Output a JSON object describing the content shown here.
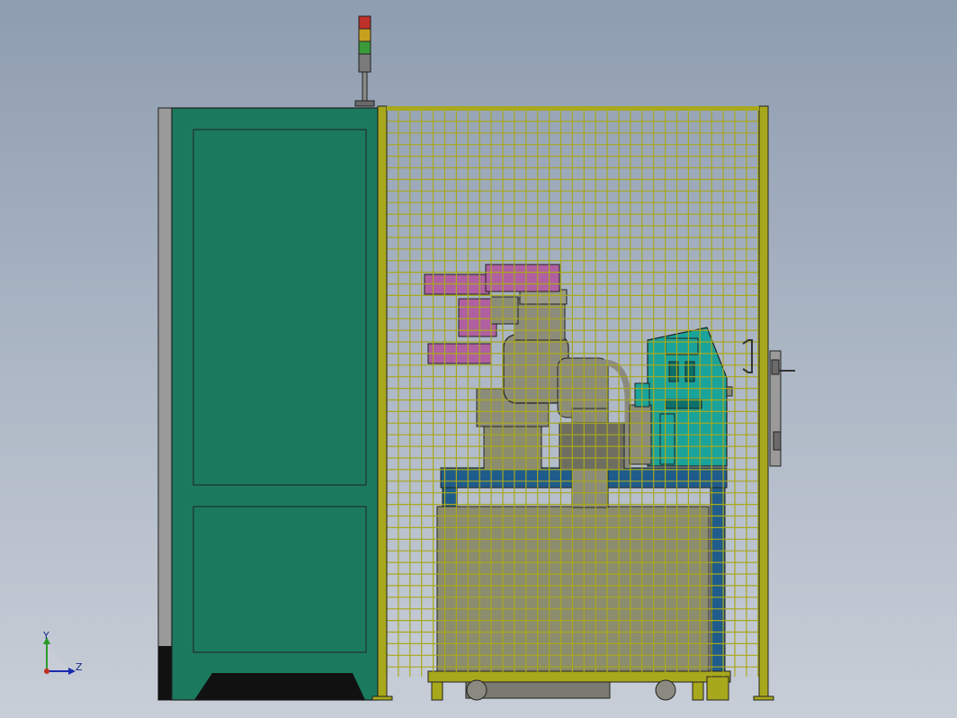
{
  "viewport": {
    "background_top": "#8e9db0",
    "background_bottom": "#c8ced7"
  },
  "colors": {
    "cabinet_green": "#1b7a5e",
    "fence_yellow": "#a8a81c",
    "frame_blue": "#1f5c8c",
    "robot_gray": "#8c8c7a",
    "magenta": "#b060a0",
    "teal": "#1aa39a",
    "beacon_red": "#c0302a",
    "beacon_amber": "#c8a020",
    "beacon_green": "#3a9a3a"
  },
  "triad": {
    "y_label": "Y",
    "z_label": "Z"
  }
}
